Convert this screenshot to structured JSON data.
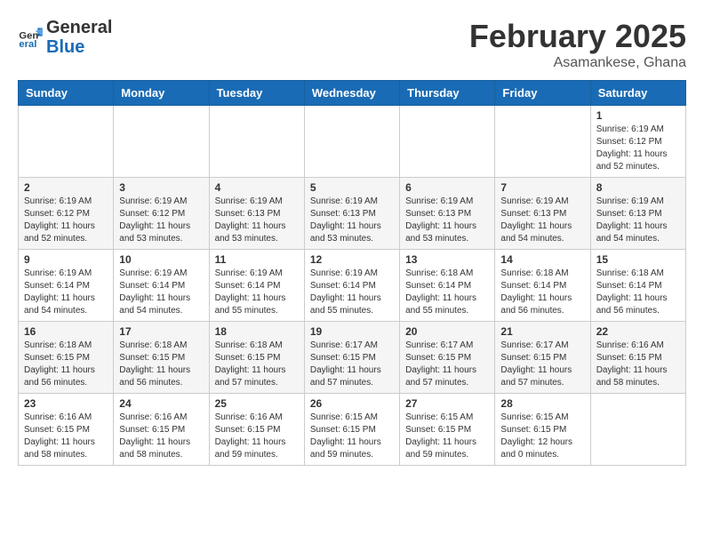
{
  "logo": {
    "text_general": "General",
    "text_blue": "Blue"
  },
  "header": {
    "month": "February 2025",
    "location": "Asamankese, Ghana"
  },
  "weekdays": [
    "Sunday",
    "Monday",
    "Tuesday",
    "Wednesday",
    "Thursday",
    "Friday",
    "Saturday"
  ],
  "weeks": [
    [
      {
        "day": "",
        "info": ""
      },
      {
        "day": "",
        "info": ""
      },
      {
        "day": "",
        "info": ""
      },
      {
        "day": "",
        "info": ""
      },
      {
        "day": "",
        "info": ""
      },
      {
        "day": "",
        "info": ""
      },
      {
        "day": "1",
        "info": "Sunrise: 6:19 AM\nSunset: 6:12 PM\nDaylight: 11 hours\nand 52 minutes."
      }
    ],
    [
      {
        "day": "2",
        "info": "Sunrise: 6:19 AM\nSunset: 6:12 PM\nDaylight: 11 hours\nand 52 minutes."
      },
      {
        "day": "3",
        "info": "Sunrise: 6:19 AM\nSunset: 6:12 PM\nDaylight: 11 hours\nand 53 minutes."
      },
      {
        "day": "4",
        "info": "Sunrise: 6:19 AM\nSunset: 6:13 PM\nDaylight: 11 hours\nand 53 minutes."
      },
      {
        "day": "5",
        "info": "Sunrise: 6:19 AM\nSunset: 6:13 PM\nDaylight: 11 hours\nand 53 minutes."
      },
      {
        "day": "6",
        "info": "Sunrise: 6:19 AM\nSunset: 6:13 PM\nDaylight: 11 hours\nand 53 minutes."
      },
      {
        "day": "7",
        "info": "Sunrise: 6:19 AM\nSunset: 6:13 PM\nDaylight: 11 hours\nand 54 minutes."
      },
      {
        "day": "8",
        "info": "Sunrise: 6:19 AM\nSunset: 6:13 PM\nDaylight: 11 hours\nand 54 minutes."
      }
    ],
    [
      {
        "day": "9",
        "info": "Sunrise: 6:19 AM\nSunset: 6:14 PM\nDaylight: 11 hours\nand 54 minutes."
      },
      {
        "day": "10",
        "info": "Sunrise: 6:19 AM\nSunset: 6:14 PM\nDaylight: 11 hours\nand 54 minutes."
      },
      {
        "day": "11",
        "info": "Sunrise: 6:19 AM\nSunset: 6:14 PM\nDaylight: 11 hours\nand 55 minutes."
      },
      {
        "day": "12",
        "info": "Sunrise: 6:19 AM\nSunset: 6:14 PM\nDaylight: 11 hours\nand 55 minutes."
      },
      {
        "day": "13",
        "info": "Sunrise: 6:18 AM\nSunset: 6:14 PM\nDaylight: 11 hours\nand 55 minutes."
      },
      {
        "day": "14",
        "info": "Sunrise: 6:18 AM\nSunset: 6:14 PM\nDaylight: 11 hours\nand 56 minutes."
      },
      {
        "day": "15",
        "info": "Sunrise: 6:18 AM\nSunset: 6:14 PM\nDaylight: 11 hours\nand 56 minutes."
      }
    ],
    [
      {
        "day": "16",
        "info": "Sunrise: 6:18 AM\nSunset: 6:15 PM\nDaylight: 11 hours\nand 56 minutes."
      },
      {
        "day": "17",
        "info": "Sunrise: 6:18 AM\nSunset: 6:15 PM\nDaylight: 11 hours\nand 56 minutes."
      },
      {
        "day": "18",
        "info": "Sunrise: 6:18 AM\nSunset: 6:15 PM\nDaylight: 11 hours\nand 57 minutes."
      },
      {
        "day": "19",
        "info": "Sunrise: 6:17 AM\nSunset: 6:15 PM\nDaylight: 11 hours\nand 57 minutes."
      },
      {
        "day": "20",
        "info": "Sunrise: 6:17 AM\nSunset: 6:15 PM\nDaylight: 11 hours\nand 57 minutes."
      },
      {
        "day": "21",
        "info": "Sunrise: 6:17 AM\nSunset: 6:15 PM\nDaylight: 11 hours\nand 57 minutes."
      },
      {
        "day": "22",
        "info": "Sunrise: 6:16 AM\nSunset: 6:15 PM\nDaylight: 11 hours\nand 58 minutes."
      }
    ],
    [
      {
        "day": "23",
        "info": "Sunrise: 6:16 AM\nSunset: 6:15 PM\nDaylight: 11 hours\nand 58 minutes."
      },
      {
        "day": "24",
        "info": "Sunrise: 6:16 AM\nSunset: 6:15 PM\nDaylight: 11 hours\nand 58 minutes."
      },
      {
        "day": "25",
        "info": "Sunrise: 6:16 AM\nSunset: 6:15 PM\nDaylight: 11 hours\nand 59 minutes."
      },
      {
        "day": "26",
        "info": "Sunrise: 6:15 AM\nSunset: 6:15 PM\nDaylight: 11 hours\nand 59 minutes."
      },
      {
        "day": "27",
        "info": "Sunrise: 6:15 AM\nSunset: 6:15 PM\nDaylight: 11 hours\nand 59 minutes."
      },
      {
        "day": "28",
        "info": "Sunrise: 6:15 AM\nSunset: 6:15 PM\nDaylight: 12 hours\nand 0 minutes."
      },
      {
        "day": "",
        "info": ""
      }
    ]
  ]
}
